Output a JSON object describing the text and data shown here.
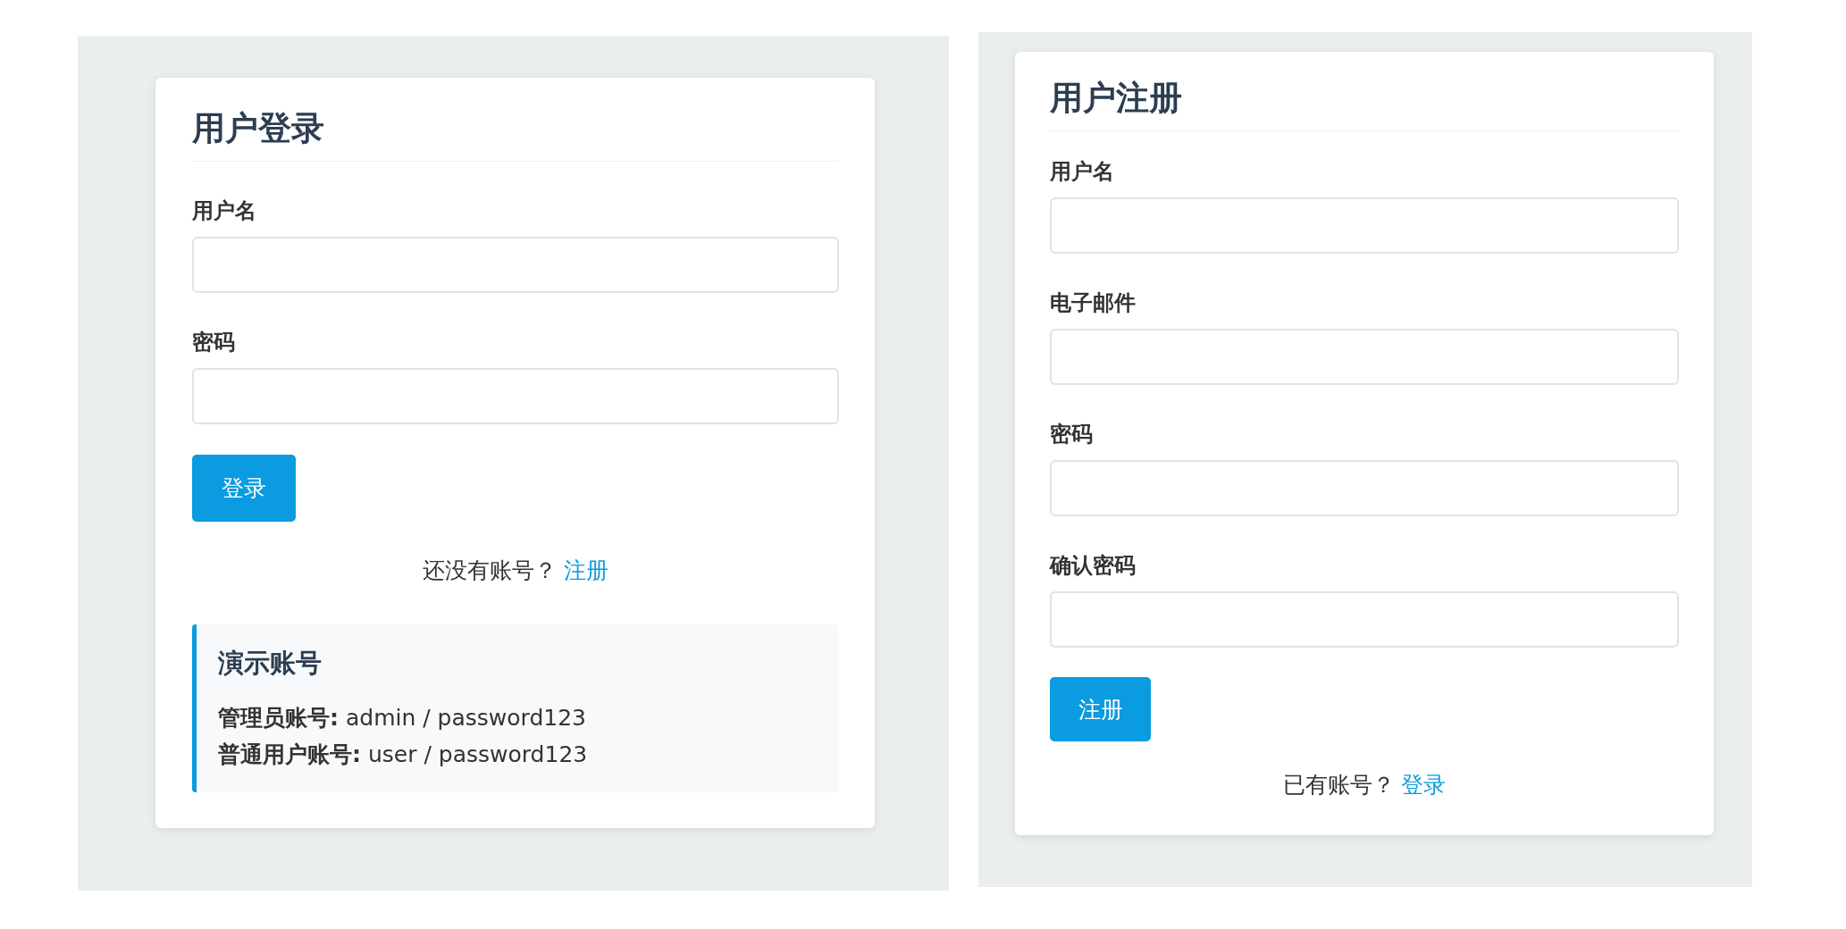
{
  "login": {
    "title": "用户登录",
    "fields": [
      {
        "label": "用户名"
      },
      {
        "label": "密码"
      }
    ],
    "submit": "登录",
    "prompt": "还没有账号？",
    "link": "注册",
    "demo": {
      "title": "演示账号",
      "lines": [
        "**管理员账号:** admin / password123",
        "**普通用户账号:** user / password123"
      ]
    }
  },
  "register": {
    "title": "用户注册",
    "fields": [
      {
        "label": "用户名"
      },
      {
        "label": "电子邮件"
      },
      {
        "label": "密码"
      },
      {
        "label": "确认密码"
      }
    ],
    "submit": "注册",
    "prompt": "已有账号？",
    "link": "登录"
  }
}
